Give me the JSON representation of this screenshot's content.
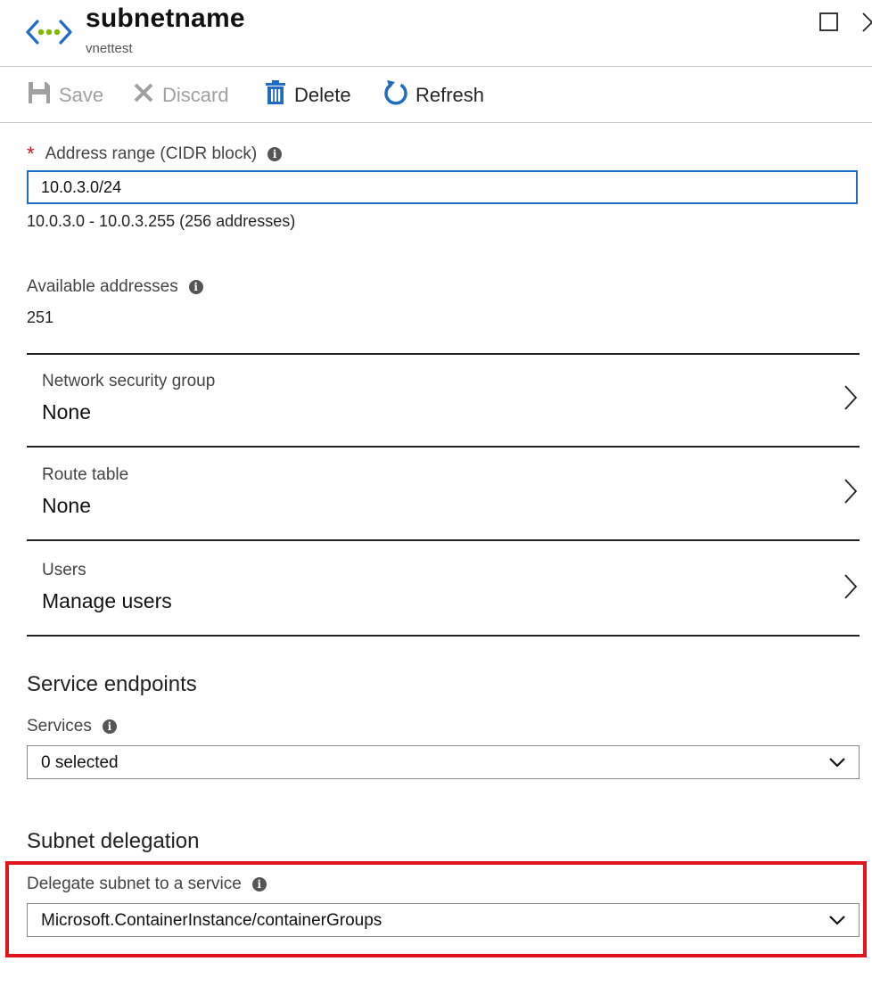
{
  "header": {
    "title": "subnetname",
    "subtitle": "vnettest"
  },
  "toolbar": {
    "save_label": "Save",
    "discard_label": "Discard",
    "delete_label": "Delete",
    "refresh_label": "Refresh"
  },
  "address_range": {
    "label": "Address range (CIDR block)",
    "required_marker": "*",
    "value": "10.0.3.0/24",
    "range_text": "10.0.3.0 - 10.0.3.255 (256 addresses)"
  },
  "available_addresses": {
    "label": "Available addresses",
    "value": "251"
  },
  "nav_rows": [
    {
      "label": "Network security group",
      "value": "None"
    },
    {
      "label": "Route table",
      "value": "None"
    },
    {
      "label": "Users",
      "value": "Manage users"
    }
  ],
  "service_endpoints": {
    "title": "Service endpoints",
    "services_label": "Services",
    "services_value": "0 selected"
  },
  "subnet_delegation": {
    "title": "Subnet delegation",
    "delegate_label": "Delegate subnet to a service",
    "delegate_value": "Microsoft.ContainerInstance/containerGroups"
  },
  "colors": {
    "accent_blue": "#1f6dc2",
    "highlight_red": "#e2141e",
    "required_red": "#e00b1c",
    "vnet_green": "#7fba00"
  }
}
